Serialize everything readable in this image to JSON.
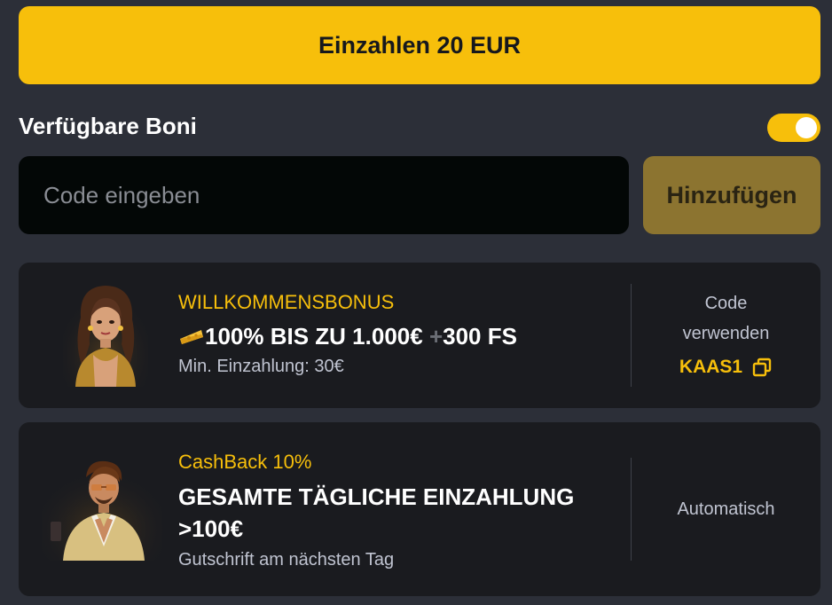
{
  "deposit": {
    "label": "Einzahlen 20 EUR"
  },
  "bonus_section": {
    "title": "Verfügbare Boni",
    "toggle_on": true
  },
  "code_input": {
    "placeholder": "Code eingeben",
    "value": ""
  },
  "add_button": {
    "label": "Hinzufügen"
  },
  "bonuses": [
    {
      "label": "WILLKOMMENSBONUS",
      "headline_main": "100% BIS ZU 1.000€",
      "headline_plus": "+",
      "headline_extra": "300 FS",
      "sub": "Min. Einzahlung: 30€",
      "side_line1": "Code",
      "side_line2": "verwenden",
      "code": "KAAS1"
    },
    {
      "label": "CashBack 10%",
      "headline_line1": "GESAMTE TÄGLICHE EINZAHLUNG",
      "headline_line2": ">100€",
      "sub": "Gutschrift am nächsten Tag",
      "side": "Automatisch"
    }
  ],
  "colors": {
    "background": "#2c2f38",
    "accent": "#f7bf0b",
    "card": "#1a1b1f",
    "input": "#030706",
    "add_button": "#8c7430"
  }
}
